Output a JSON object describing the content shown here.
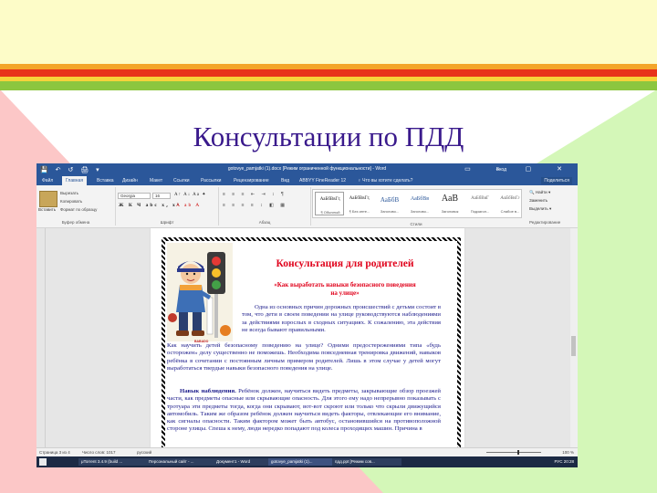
{
  "slide": {
    "title": "Консультации по ПДД"
  },
  "word": {
    "quick_access": "💾 ↶ ↺ 🖨 ▾",
    "document_title": "gotovye_pamjatki (1).docx [Режим ограниченной функциональности] - Word",
    "signin": "Вход",
    "window_controls": "▭ – ▢ ✕",
    "tabs": [
      "Файл",
      "Главная",
      "Вставка",
      "Дизайн",
      "Макет",
      "Ссылки",
      "Рассылки",
      "Рецензирование",
      "Вид",
      "ABBYY FineReader 12",
      "♀ Что вы хотите сделать?"
    ],
    "share": "Поделиться",
    "clipboard": {
      "paste": "Вставить",
      "cut": "Вырезать",
      "copy": "Копировать",
      "format_painter": "Формат по образцу",
      "label": "Буфер обмена"
    },
    "font": {
      "name": "Georgia",
      "size": "16",
      "label": "Шрифт",
      "row1": "A↑ A↓ Aa ✦",
      "row2": "Ж К Ч abc x₂ x²",
      "row3": "A ab A"
    },
    "paragraph": {
      "label": "Абзац",
      "row1": "≡ ≡ ≡ ⇤ ⇥ ↕ ¶",
      "row2": "≡ ≡ ≡ ≡ ↕ ◧ ▦"
    },
    "styles": {
      "label": "Стили",
      "items": [
        {
          "preview": "АаБбВвГг,",
          "name": "¶ Обычный"
        },
        {
          "preview": "АаБбВвГг,",
          "name": "¶ Без инте..."
        },
        {
          "preview": "АаБбВ",
          "name": "Заголово..."
        },
        {
          "preview": "АаБбВв",
          "name": "Заголово..."
        },
        {
          "preview": "АаВ",
          "name": "Заголовок"
        },
        {
          "preview": "АаБбВвГ",
          "name": "Подзагол..."
        },
        {
          "preview": "АаБбВвГг",
          "name": "Слабое в..."
        }
      ]
    },
    "editing": {
      "label": "Редактирование",
      "find": "🔍 Найти ▾",
      "replace": "Заменить",
      "select": "Выделить ▾"
    },
    "document": {
      "caption": "BABADO",
      "heading": "Консультация для родителей",
      "subheading_1": "«Как выработать навыки безопасного поведения",
      "subheading_2": "на улице»",
      "p1": "Одна из основных причин дорожных происшествий с детьми состоит в том, что дети в своем поведении на улице руководствуются наблюдениями за действиями взрослых в сходных ситуациях. К сожалению, эта действия не всегда бывают правильными.",
      "p2": "Как научить детей безопасному поведению на улице? Одними предостережениями типа «будь осторожен» делу существенно не поможешь. Необходима повседневная тренировка движений, навыков ребёнка в сочетании с постоянным личным примером родителей. Лишь в этом случае у детей могут выработаться твердые навыки безопасного поведения на улице.",
      "p3_bold": "Навык наблюдения.",
      "p3": " Ребёнок должен, научиться видеть предметы, закрывающие обзор проезжей части, как предметы опасные или скрывающие опасность. Для этого ему надо непрерывно показывать с тротуара эти предметы тогда, когда они скрывают, вот-вот скроют или только что скрыли движущийся автомобиль. Таким же образом ребёнок должен научиться видеть факторы, отвлекающие его внимание, как сигналы опасности. Таким фактором может быть автобус, остановившийся на противоположной стороне улицы. Спеша к нему, люди нередко попадают под колеса проходящих машин. Причина в"
    },
    "status": {
      "page": "Страница 3 из 4",
      "words": "Число слов: 1017",
      "language": "русский",
      "zoom": "100 %"
    },
    "taskbar": {
      "items": [
        "μTorrent 3.4.9 (build ...",
        "Персональный сайт - ...",
        "Документ1 - Word",
        "gotovye_pamjatki (1)...",
        "пдд.ppt [Режим сов..."
      ],
      "tray": "РУС   20:28"
    }
  }
}
